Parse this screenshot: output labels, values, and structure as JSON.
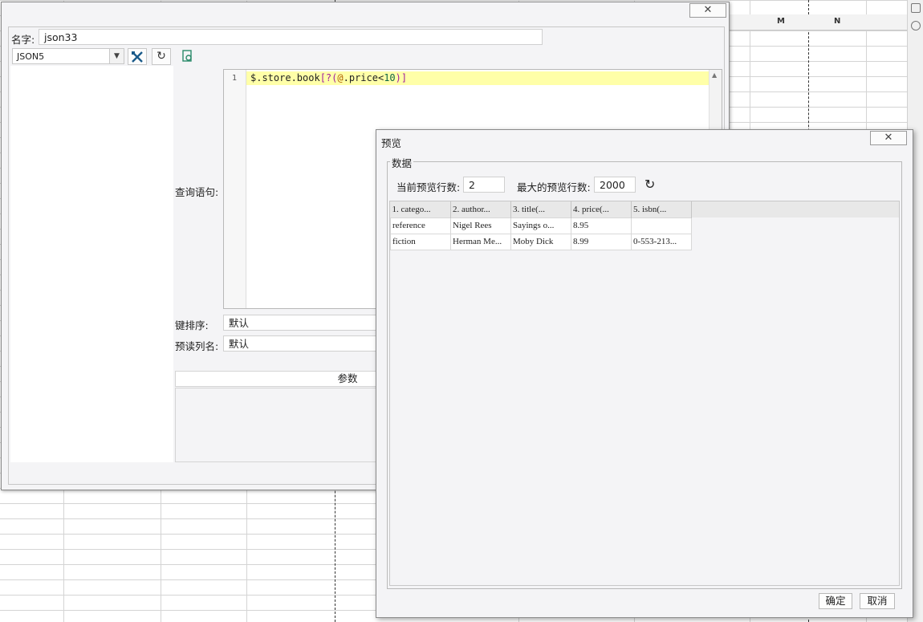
{
  "sheet": {
    "columns": [
      "M",
      "N",
      ""
    ]
  },
  "main_dialog": {
    "name_label": "名字:",
    "name_value": "json33",
    "datasource_type": "JSON5",
    "query_label": "查询语句:",
    "line_number": "1",
    "query_parts": {
      "prefix": "$.store.book",
      "open": "[?(",
      "at": "@",
      "mid": ".price<",
      "num": "10",
      "close": ")]"
    },
    "key_sort_label": "键排序:",
    "key_sort_value": "默认",
    "preview_col_label": "预读列名:",
    "preview_col_value": "默认",
    "params_header": "参数"
  },
  "preview_dialog": {
    "title": "预览",
    "group_label": "数据",
    "current_rows_label": "当前预览行数:",
    "current_rows_value": "2",
    "max_rows_label": "最大的预览行数:",
    "max_rows_value": "2000",
    "columns": [
      "1. catego...",
      "2. author...",
      "3. title(...",
      "4. price(...",
      "5. isbn(..."
    ],
    "rows": [
      [
        "reference",
        "Nigel Rees",
        "Sayings o...",
        "8.95",
        ""
      ],
      [
        "fiction",
        "Herman Me...",
        "Moby Dick",
        "8.99",
        "0-553-213..."
      ]
    ],
    "ok_label": "确定",
    "cancel_label": "取消"
  }
}
